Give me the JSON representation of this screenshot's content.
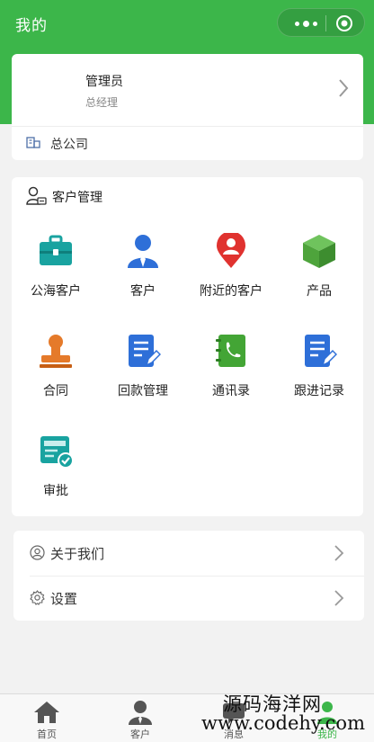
{
  "header": {
    "title": "我的"
  },
  "profile": {
    "name": "管理员",
    "role": "总经理",
    "company": "总公司"
  },
  "crm": {
    "title": "客户管理",
    "items": [
      {
        "label": "公海客户",
        "icon": "briefcase-icon"
      },
      {
        "label": "客户",
        "icon": "user-icon"
      },
      {
        "label": "附近的客户",
        "icon": "location-pin-icon"
      },
      {
        "label": "产品",
        "icon": "box-icon"
      },
      {
        "label": "合同",
        "icon": "stamp-icon"
      },
      {
        "label": "回款管理",
        "icon": "document-edit-icon"
      },
      {
        "label": "通讯录",
        "icon": "address-book-icon"
      },
      {
        "label": "跟进记录",
        "icon": "document-edit-icon"
      },
      {
        "label": "审批",
        "icon": "approval-icon"
      }
    ]
  },
  "menu": {
    "about": "关于我们",
    "settings": "设置"
  },
  "tabs": [
    {
      "label": "首页",
      "icon": "home-icon"
    },
    {
      "label": "客户",
      "icon": "customer-icon"
    },
    {
      "label": "消息",
      "icon": "message-icon"
    },
    {
      "label": "我的",
      "icon": "me-icon"
    }
  ],
  "watermark": {
    "line1": "源码海洋网",
    "line2": "www.codehy.com"
  },
  "colors": {
    "brand_green": "#3cb64a",
    "background": "#f2f2f2"
  }
}
